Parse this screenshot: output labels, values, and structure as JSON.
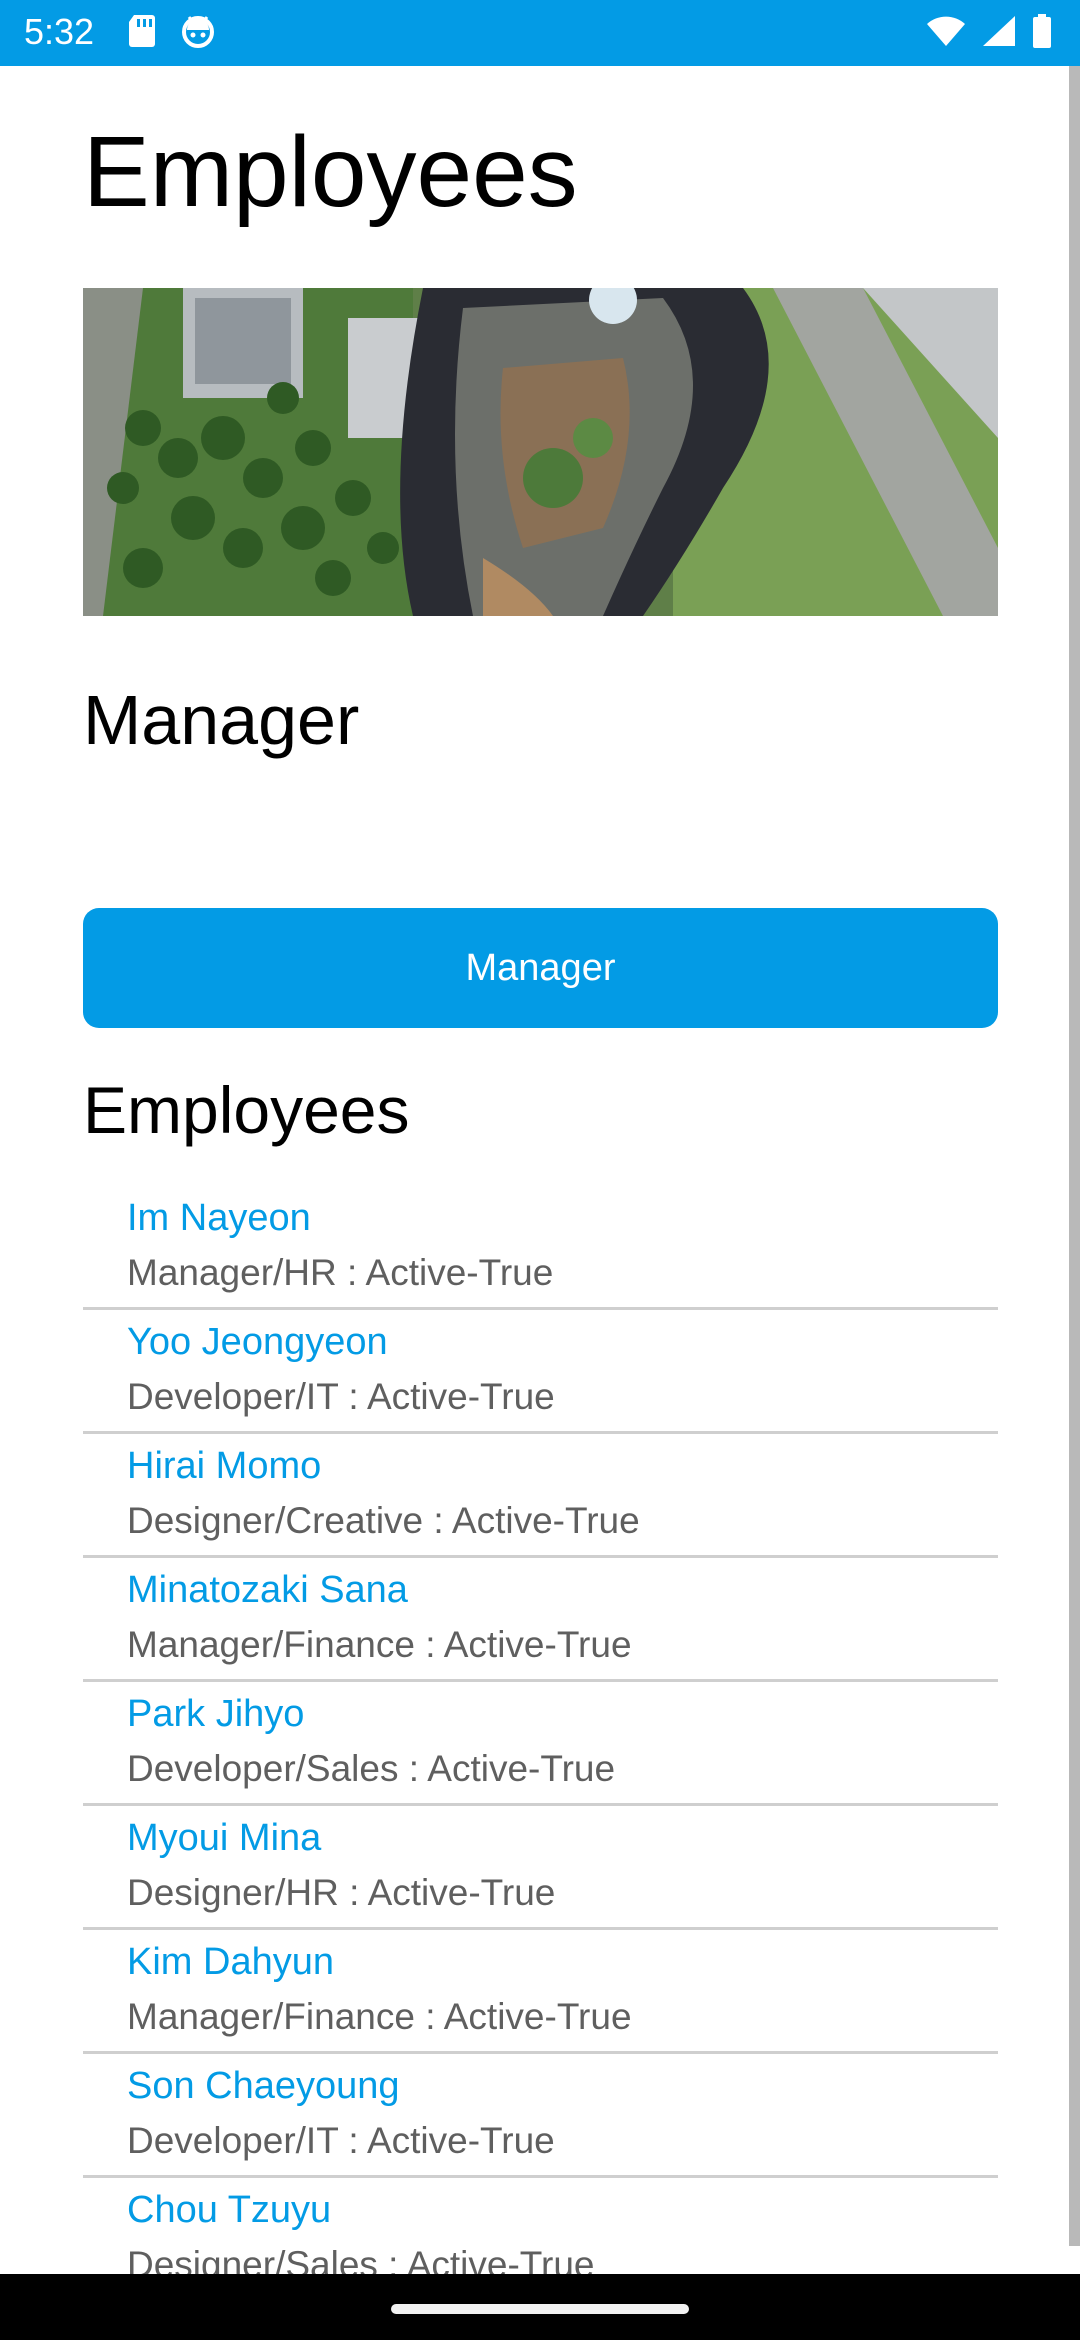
{
  "status_bar": {
    "time": "5:32",
    "left_icons": [
      "sd-card-icon",
      "android-debug-icon"
    ],
    "right_icons": [
      "wifi-icon",
      "cellular-signal-icon",
      "battery-icon"
    ],
    "background": "#039BE5"
  },
  "page": {
    "title": "Employees",
    "hero_image": "aerial-view-of-modern-office-building"
  },
  "manager_section": {
    "heading": "Manager",
    "button_label": "Manager"
  },
  "employees_section": {
    "heading": "Employees",
    "items": [
      {
        "name": "Im Nayeon",
        "detail": "Manager/HR : Active-True"
      },
      {
        "name": "Yoo Jeongyeon",
        "detail": "Developer/IT : Active-True"
      },
      {
        "name": "Hirai Momo",
        "detail": "Designer/Creative : Active-True"
      },
      {
        "name": "Minatozaki Sana",
        "detail": "Manager/Finance : Active-True"
      },
      {
        "name": "Park Jihyo",
        "detail": "Developer/Sales : Active-True"
      },
      {
        "name": "Myoui Mina",
        "detail": "Designer/HR : Active-True"
      },
      {
        "name": "Kim Dahyun",
        "detail": "Manager/Finance : Active-True"
      },
      {
        "name": "Son Chaeyoung",
        "detail": "Developer/IT : Active-True"
      },
      {
        "name": "Chou Tzuyu",
        "detail": "Designer/Sales : Active-True"
      }
    ]
  },
  "colors": {
    "accent": "#039BE5",
    "name_text": "#039BE5",
    "detail_text": "#5f5f5f",
    "divider": "#cfcfcf"
  }
}
